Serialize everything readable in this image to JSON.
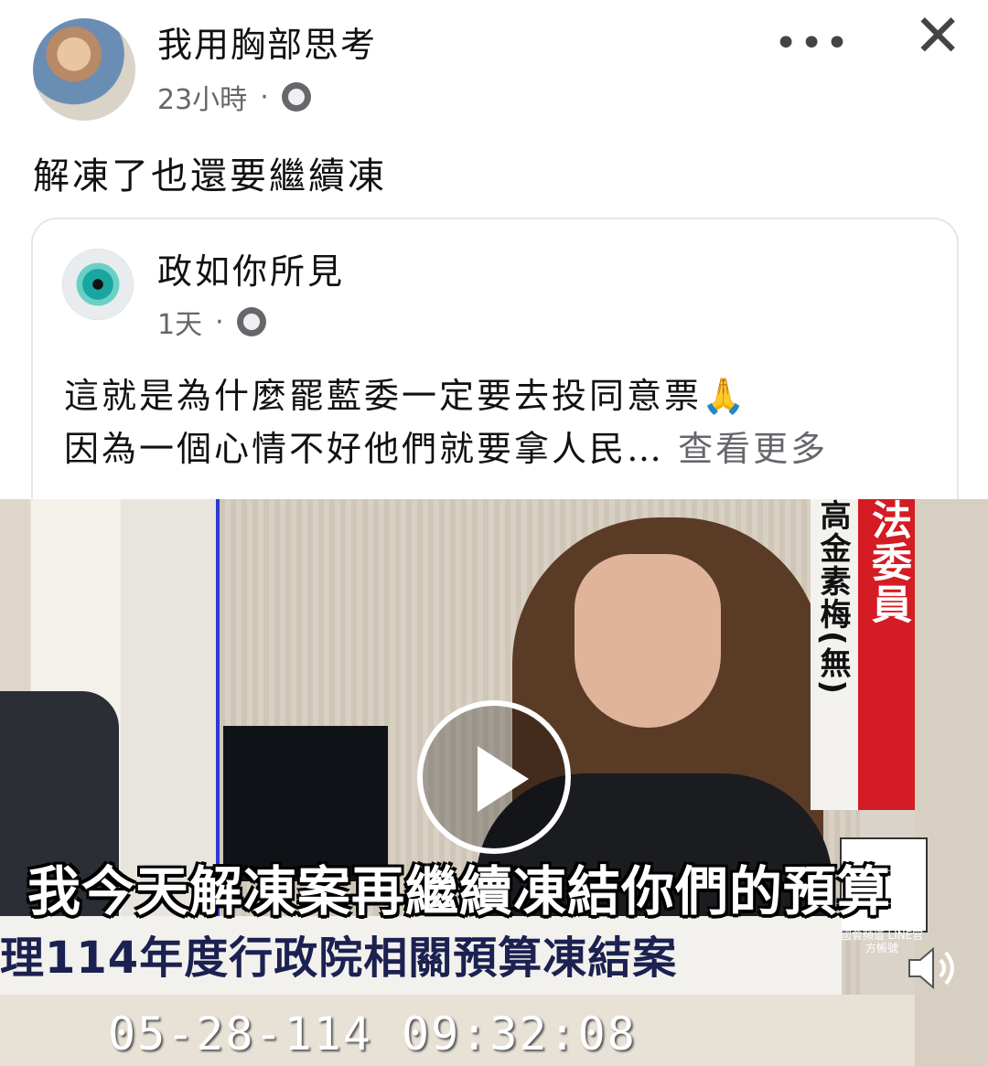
{
  "post": {
    "author": "我用胸部思考",
    "time": "23小時",
    "separator": "·",
    "privacy_icon": "globe-icon",
    "more_icon": "more-dots-icon",
    "more_label": "•••",
    "close_icon": "close-icon",
    "close_label": "✕",
    "caption": "解凍了也還要繼續凍"
  },
  "shared": {
    "author": "政如你所見",
    "time": "1天",
    "separator": "·",
    "privacy_icon": "globe-icon",
    "line1": "這就是為什麼罷藍委一定要去投同意票🙏",
    "line2": "因為一個心情不好他們就要拿人民…",
    "see_more": "查看更多"
  },
  "video": {
    "play_icon": "play-icon",
    "volume_icon": "volume-icon",
    "red_band_text": "法委員",
    "name_band_text": "高金素梅(無)",
    "subtitle": "我今天解凍案再繼續凍結你們的預算",
    "lower_third": "理114年度行政院相關預算凍結案",
    "timestamp": "05-28-114   09:32:08",
    "qr_label": "國會頻道 LINE官方帳號"
  }
}
